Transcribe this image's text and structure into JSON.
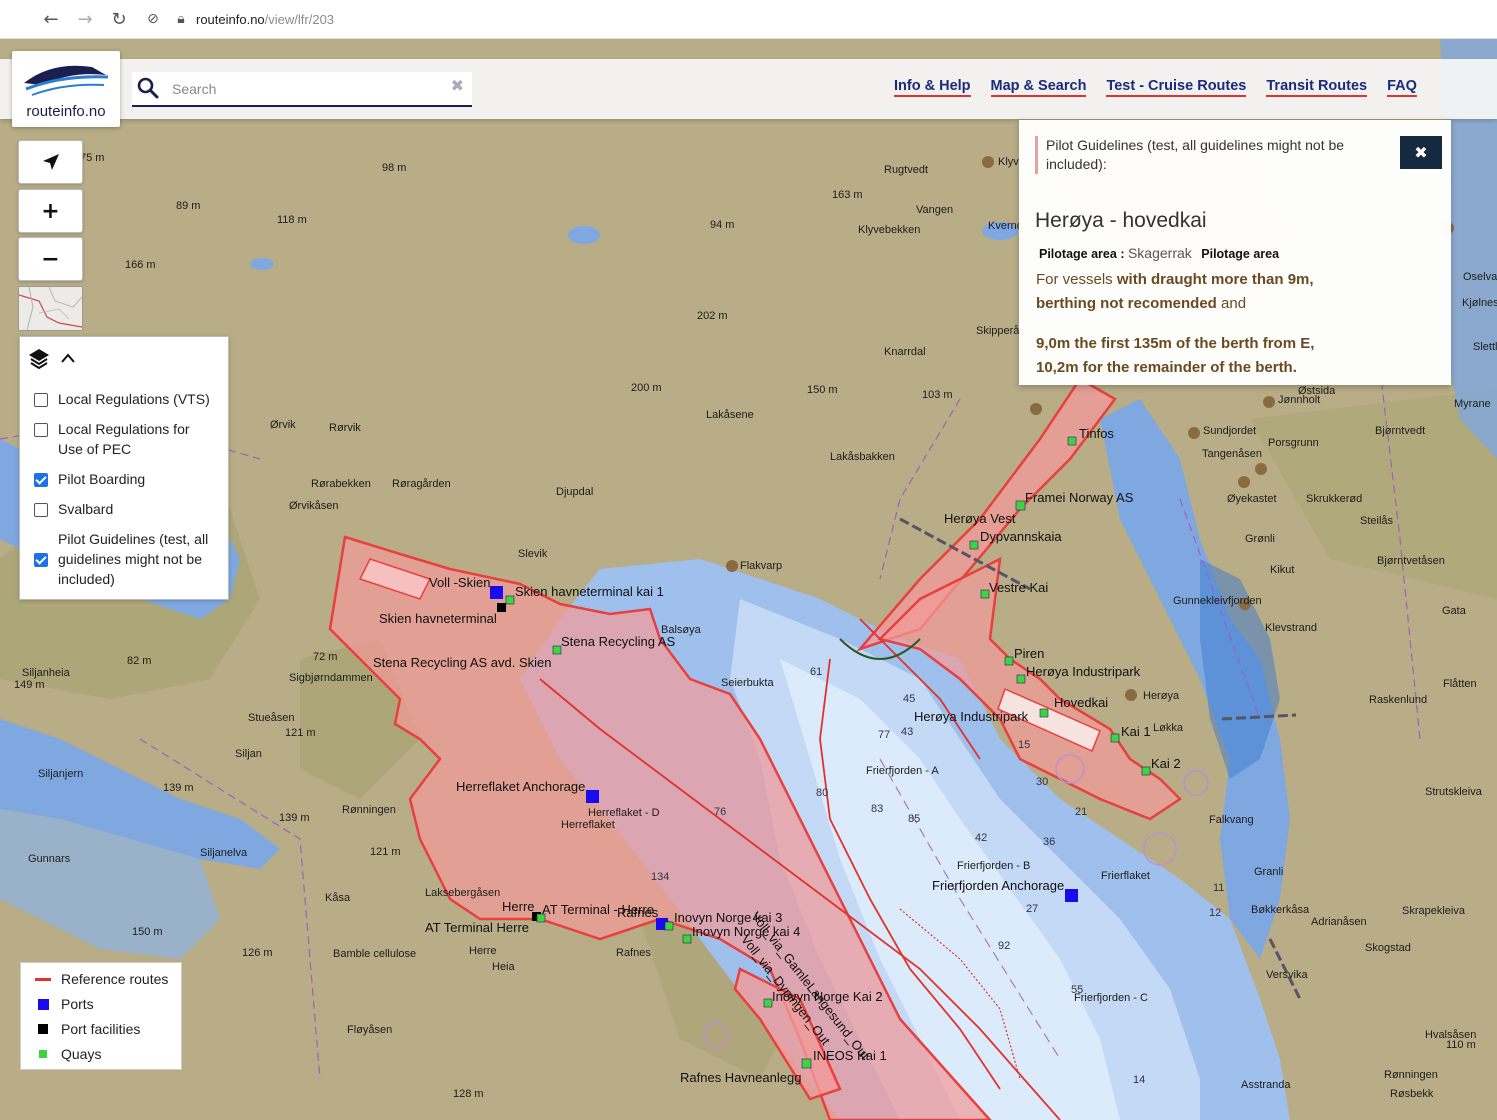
{
  "browser": {
    "back": "←",
    "forward": "→",
    "reload": "↻",
    "url_host": "routeinfo.no",
    "url_path": "/view/lfr/203"
  },
  "header": {
    "logo_text": "routeinfo.no",
    "search_placeholder": "Search",
    "clear": "✖",
    "nav": [
      "Info & Help",
      "Map & Search",
      "Test - Cruise Routes",
      "Transit Routes",
      "FAQ"
    ]
  },
  "controls": {
    "locate": "➤",
    "zoom_in": "+",
    "zoom_out": "−"
  },
  "layers": {
    "items": [
      {
        "label": "Local Regulations (VTS)",
        "checked": false
      },
      {
        "label": "Local Regulations for Use of PEC",
        "checked": false
      },
      {
        "label": "Pilot Boarding",
        "checked": true
      },
      {
        "label": "Svalbard",
        "checked": false
      },
      {
        "label": "Pilot Guidelines (test, all guidelines might not be included)",
        "checked": true
      }
    ]
  },
  "legend": {
    "items": [
      {
        "label": "Reference routes",
        "color": "#e0332b",
        "shape": "line"
      },
      {
        "label": "Ports",
        "color": "#1a0af0",
        "shape": "square"
      },
      {
        "label": "Port facilities",
        "color": "#000000",
        "shape": "square"
      },
      {
        "label": "Quays",
        "color": "#3fd43f",
        "shape": "square"
      }
    ]
  },
  "popup": {
    "notice": "Pilot Guidelines (test, all guidelines might not be included):",
    "close": "✖",
    "title": "Herøya - hovedkai",
    "pilotage_label_1": "Pilotage area",
    "pilotage_sep": ":",
    "pilotage_value": "Skagerrak",
    "pilotage_label_2": "Pilotage area",
    "para1_a": "For vessels",
    "para1_b": "with draught more than 9m,",
    "para1_c": "berthing not recomended",
    "para1_d": "and",
    "para2_a": "9,0m the first 135m of the berth from E,",
    "para2_b": "10,2m for the remainder of the berth."
  },
  "map": {
    "colors": {
      "land": "#b8ad86",
      "forest": "#a3a06d",
      "water_shallow": "#7fa8e0",
      "water_mid": "#b5d0f2",
      "water_deep": "#dcebfb",
      "area_fill": "#f29a9a",
      "area_stroke": "#e8403c"
    },
    "place_names": [
      "Rugtvedt",
      "Vangen",
      "Klyvebekken",
      "Knarrdal",
      "Lakåsene",
      "Lakåsbakken",
      "Djupdal",
      "Ørvik",
      "Rørvik",
      "Rørabekken",
      "Røragården",
      "Ørvikåsen",
      "Slevik",
      "Flakvarp",
      "Balsøya",
      "Seierbukta",
      "Sigbjørndammen",
      "Stueåsen",
      "Siljan",
      "Siljanjern",
      "Siljanheia",
      "Rønningen",
      "Gunnars",
      "Siljanelva",
      "Kåsa",
      "Laksebergåsen",
      "Bamble cellulose",
      "Herre",
      "Heia",
      "Fløyåsen",
      "Rafnes",
      "Sundjordet",
      "Porsgrunn",
      "Tangenåsen",
      "Bjørntvedt",
      "Øyekastet",
      "Skrukkerød",
      "Steilås",
      "Grønli",
      "Kikut",
      "Gunnekleivfjorden",
      "Bjørntvetåsen",
      "Klevstrand",
      "Gata",
      "Raskenlund",
      "Flåtten",
      "Herøya",
      "Løkka",
      "Falkvang",
      "Strutskleiva",
      "Granli",
      "Bøkkerkåsa",
      "Adrianåsen",
      "Skrapekleiva",
      "Skogstad",
      "Versvika",
      "Hvalsåsen",
      "Rønningen",
      "Asstranda",
      "Røsbekk",
      "Slettl",
      "Kjølnes",
      "Oselva",
      "Myrane",
      "Jønnholt",
      "Østsida",
      "Kverno",
      "Klyv",
      "Skipperå",
      "Vestre Kai"
    ],
    "feature_names": [
      "Voll -Skien",
      "Skien havneterminal kai 1",
      "Skien havneterminal",
      "Stena Recycling AS",
      "Stena Recycling AS avd. Skien",
      "Herreflaket Anchorage",
      "Herre",
      "AT Terminal - Herre",
      "AT Terminal Herre",
      "Rafnes",
      "Inovyn Norge kai 3",
      "Inovyn Norge kai 4",
      "Inovyn Norge Kai 2",
      "INEOS Kai 1",
      "Rafnes Havneanlegg",
      "Herøya Vest",
      "Dypvannskaia",
      "Vestre Kai",
      "Framei Norway AS",
      "Tinfos",
      "Piren",
      "Herøya Industripark",
      "Hovedkai",
      "Kai 1",
      "Kai 2",
      "Frierfjorden Anchorage",
      "Frierfjorden - A",
      "Frierfjorden - B",
      "Frierfjorden - C",
      "Frierflaket",
      "Herreflaket",
      "Herreflaket - D",
      "Voll_via_GamleLangesund_Out",
      "Voll_via_Dypingen_Out"
    ],
    "height_labels": [
      "75 m",
      "98 m",
      "89 m",
      "118 m",
      "166 m",
      "163 m",
      "94 m",
      "202 m",
      "200 m",
      "150 m",
      "103 m",
      "82 m",
      "72 m",
      "149 m",
      "121 m",
      "139 m",
      "139 m",
      "121 m",
      "150 m",
      "126 m",
      "128 m",
      "110 m"
    ],
    "depth_labels": [
      "61",
      "45",
      "77",
      "43",
      "80",
      "83",
      "85",
      "42",
      "36",
      "21",
      "27",
      "92",
      "55",
      "15",
      "30",
      "14",
      "11",
      "12",
      "76",
      "134"
    ]
  }
}
